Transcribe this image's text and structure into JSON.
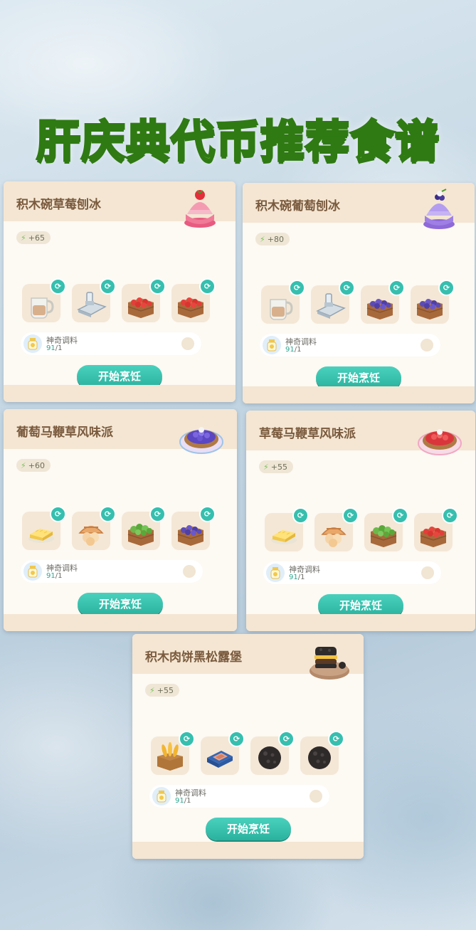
{
  "banner_title": "肝庆典代币推荐食谱",
  "common": {
    "seasoning_name": "神奇调料",
    "seasoning_have": "91",
    "seasoning_need": "/1",
    "cook_label": "开始烹饪",
    "swap_glyph": "⟳",
    "energy_glyph": "⚡"
  },
  "recipes": [
    {
      "name": "积木碗草莓刨冰",
      "energy": "+65",
      "dish_icon": "strawberry-shaved-ice",
      "ingredients": [
        "milk-jug-icon",
        "ice-tray-icon",
        "strawberry-crate-icon",
        "strawberry-crate-icon"
      ]
    },
    {
      "name": "积木碗葡萄刨冰",
      "energy": "+80",
      "dish_icon": "grape-shaved-ice",
      "ingredients": [
        "milk-jug-icon",
        "ice-tray-icon",
        "grape-crate-icon",
        "grape-crate-icon"
      ]
    },
    {
      "name": "葡萄马鞭草风味派",
      "energy": "+60",
      "dish_icon": "grape-pie",
      "ingredients": [
        "butter-icon",
        "egg-basket-icon",
        "verbena-crate-icon",
        "grape-crate-icon"
      ]
    },
    {
      "name": "草莓马鞭草风味派",
      "energy": "+55",
      "dish_icon": "strawberry-pie",
      "ingredients": [
        "butter-icon",
        "egg-basket-icon",
        "verbena-crate-icon",
        "strawberry-crate-icon"
      ]
    },
    {
      "name": "积木肉饼黑松露堡",
      "energy": "+55",
      "dish_icon": "truffle-burger",
      "ingredients": [
        "wheat-crate-icon",
        "meat-package-icon",
        "black-truffle-icon",
        "black-truffle-icon"
      ]
    }
  ],
  "colors": {
    "accent": "#36bfae",
    "card_header": "#f4e6d3",
    "title_green": "#7fcf3a"
  }
}
